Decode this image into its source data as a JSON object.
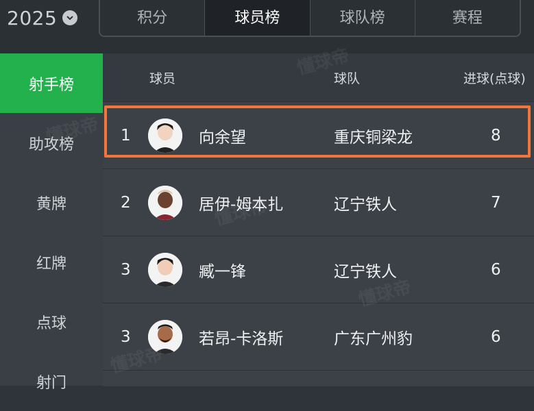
{
  "season": {
    "label": "2025",
    "icon": "chevron-down-icon"
  },
  "tabs": [
    {
      "label": "积分",
      "active": false
    },
    {
      "label": "球员榜",
      "active": true
    },
    {
      "label": "球队榜",
      "active": false
    },
    {
      "label": "赛程",
      "active": false
    }
  ],
  "sidebar": {
    "items": [
      {
        "label": "射手榜",
        "active": true
      },
      {
        "label": "助攻榜",
        "active": false
      },
      {
        "label": "黄牌",
        "active": false
      },
      {
        "label": "红牌",
        "active": false
      },
      {
        "label": "点球",
        "active": false
      },
      {
        "label": "射门",
        "active": false
      }
    ]
  },
  "table": {
    "headers": {
      "player": "球员",
      "team": "球队",
      "goals": "进球(点球)"
    },
    "rows": [
      {
        "rank": "1",
        "player": "向余望",
        "team": "重庆铜梁龙",
        "goals": "8"
      },
      {
        "rank": "2",
        "player": "居伊-姆本扎",
        "team": "辽宁铁人",
        "goals": "7"
      },
      {
        "rank": "3",
        "player": "臧一锋",
        "team": "辽宁铁人",
        "goals": "6"
      },
      {
        "rank": "3",
        "player": "若昂-卡洛斯",
        "team": "广东广州豹",
        "goals": "6"
      }
    ]
  },
  "watermark": "懂球帝",
  "colors": {
    "accent_green": "#22b14c",
    "highlight_orange": "#f2763a"
  }
}
